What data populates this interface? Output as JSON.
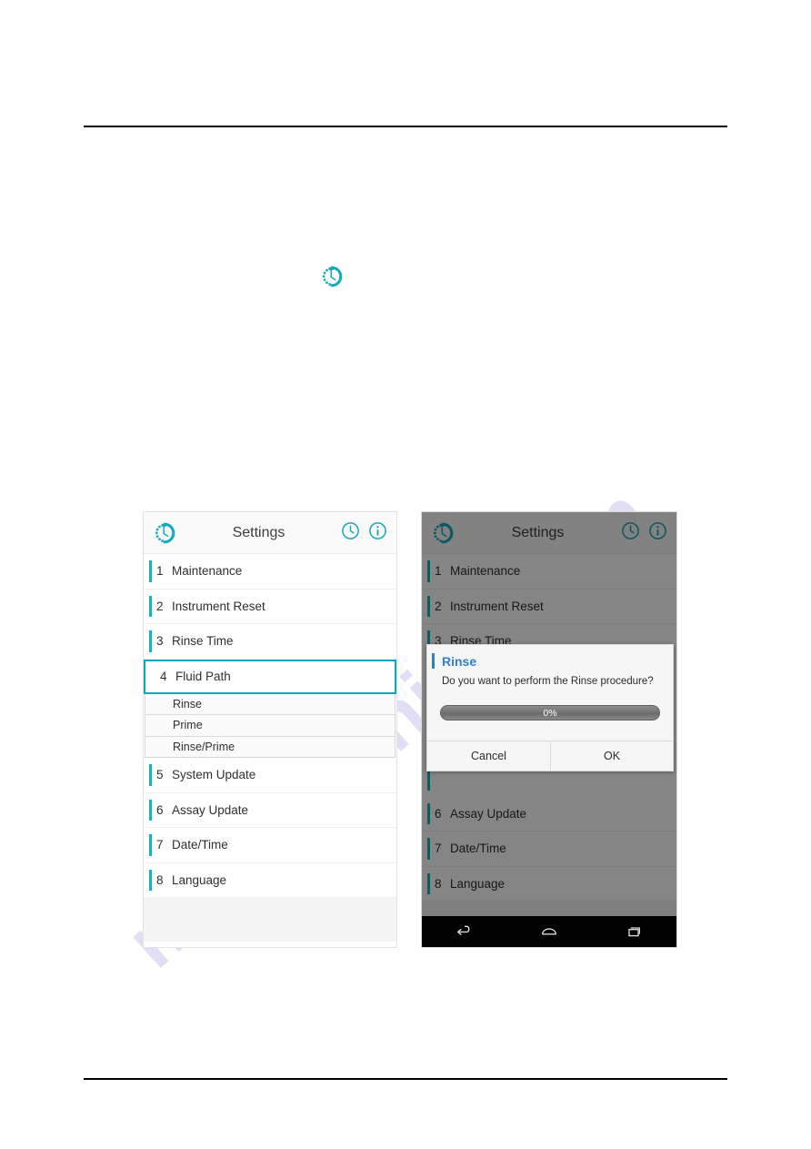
{
  "figure": {
    "inline_icon": "settings-spinner-icon"
  },
  "watermark": {
    "text": "manualshive.com"
  },
  "colors": {
    "accent_teal": "#12b5c4",
    "dialog_title_blue": "#2f7fd0",
    "selected_border": "#0fa8b8",
    "watermark": "#c9c4f0"
  },
  "left_device": {
    "appbar": {
      "spinner_icon": "settings-spinner-icon",
      "title": "Settings",
      "clock_icon": "clock-icon",
      "info_icon": "info-icon"
    },
    "items": [
      {
        "num": "1",
        "label": "Maintenance"
      },
      {
        "num": "2",
        "label": "Instrument Reset"
      },
      {
        "num": "3",
        "label": "Rinse Time"
      },
      {
        "num": "4",
        "label": "Fluid Path"
      },
      {
        "num": "5",
        "label": "System Update"
      },
      {
        "num": "6",
        "label": "Assay Update"
      },
      {
        "num": "7",
        "label": "Date/Time"
      },
      {
        "num": "8",
        "label": "Language"
      }
    ],
    "submenu": [
      {
        "label": "Rinse"
      },
      {
        "label": "Prime"
      },
      {
        "label": "Rinse/Prime"
      }
    ]
  },
  "right_device": {
    "appbar": {
      "spinner_icon": "settings-spinner-icon",
      "title": "Settings",
      "clock_icon": "clock-icon",
      "info_icon": "info-icon"
    },
    "items": [
      {
        "num": "1",
        "label": "Maintenance"
      },
      {
        "num": "2",
        "label": "Instrument Reset"
      },
      {
        "num": "3",
        "label": "Rinse Time"
      },
      {
        "num": "6",
        "label": "Assay Update"
      },
      {
        "num": "7",
        "label": "Date/Time"
      },
      {
        "num": "8",
        "label": "Language"
      }
    ],
    "dialog": {
      "title": "Rinse",
      "message": "Do you want to perform the Rinse procedure?",
      "progress_pct": "0%",
      "progress_value": 0,
      "cancel_label": "Cancel",
      "ok_label": "OK"
    },
    "navbar": {
      "back_icon": "back-icon",
      "home_icon": "home-icon",
      "recents_icon": "recents-icon"
    }
  }
}
